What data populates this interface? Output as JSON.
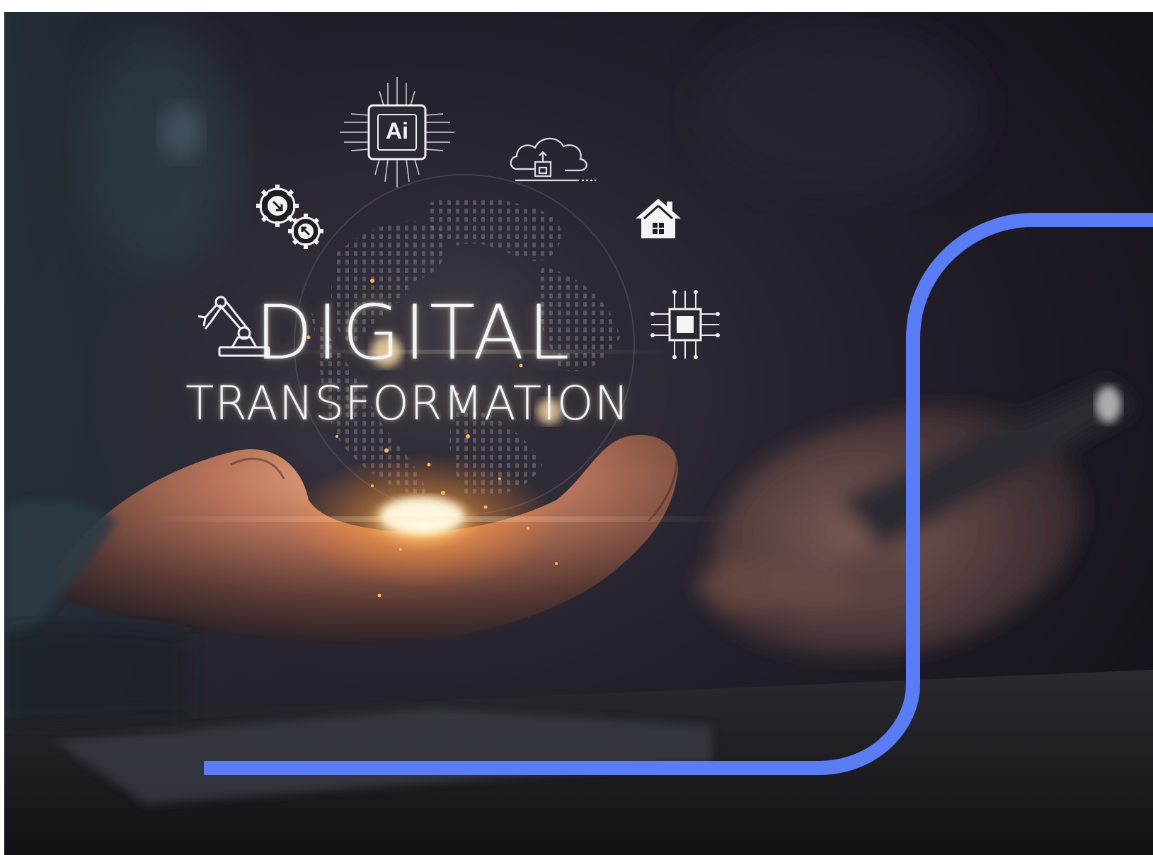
{
  "image": {
    "title_line1": "DIGITAL",
    "title_line2": "TRANSFORMATION",
    "chip_label": "Ai",
    "icons": [
      "ai-chip-icon",
      "cloud-upload-icon",
      "gears-icon",
      "home-icon",
      "robot-arm-icon",
      "microchip-icon"
    ],
    "colors": {
      "background": "#1d1a24",
      "accent_frame": "#5a7cf5",
      "glow": "#ffb35c",
      "text": "#f2f4f7"
    }
  }
}
